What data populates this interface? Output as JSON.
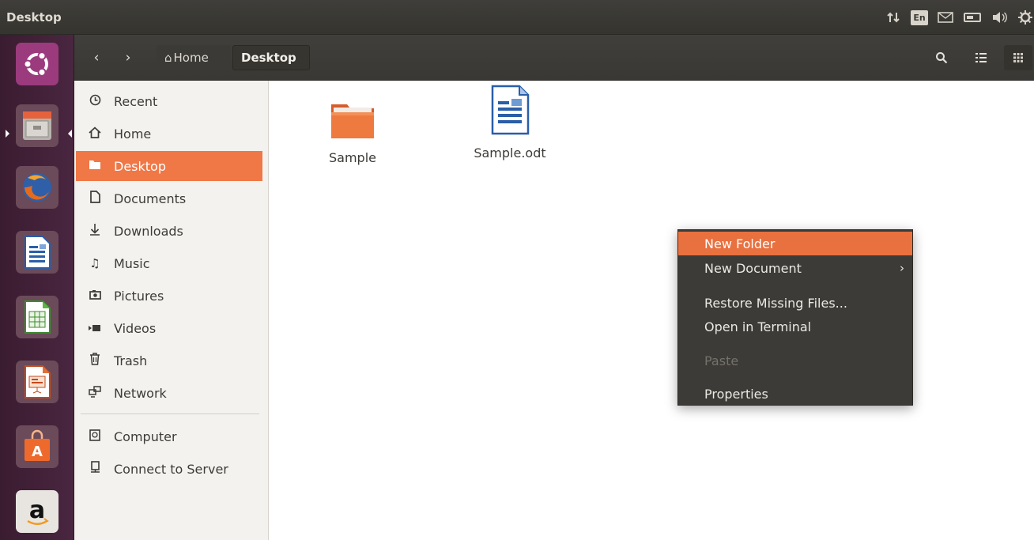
{
  "window": {
    "title": "Desktop"
  },
  "indicators": {
    "network": "network-updown-icon",
    "language": "En",
    "mail": "mail-icon",
    "battery": "battery-icon",
    "volume": "volume-icon",
    "settings": "gear-icon"
  },
  "launcher": {
    "items": [
      {
        "name": "ubuntu-dash",
        "icon": "ubuntu-logo-icon"
      },
      {
        "name": "files",
        "icon": "file-cabinet-icon"
      },
      {
        "name": "firefox",
        "icon": "firefox-icon"
      },
      {
        "name": "writer",
        "icon": "document-icon"
      },
      {
        "name": "calc",
        "icon": "spreadsheet-icon"
      },
      {
        "name": "impress",
        "icon": "presentation-icon"
      },
      {
        "name": "software-center",
        "icon": "shopping-bag-icon"
      },
      {
        "name": "amazon",
        "icon": "amazon-icon"
      }
    ]
  },
  "toolbar": {
    "back": "‹",
    "forward": "›",
    "breadcrumbs": [
      "Home",
      "Desktop"
    ],
    "search_icon": "search-icon",
    "list_view_icon": "list-view-icon",
    "grid_view_icon": "grid-view-icon"
  },
  "sidebar": {
    "items": [
      {
        "label": "Recent",
        "icon": "clock-icon"
      },
      {
        "label": "Home",
        "icon": "home-icon"
      },
      {
        "label": "Desktop",
        "icon": "folder-icon",
        "active": true
      },
      {
        "label": "Documents",
        "icon": "document-icon"
      },
      {
        "label": "Downloads",
        "icon": "download-icon"
      },
      {
        "label": "Music",
        "icon": "music-icon"
      },
      {
        "label": "Pictures",
        "icon": "camera-icon"
      },
      {
        "label": "Videos",
        "icon": "video-icon"
      },
      {
        "label": "Trash",
        "icon": "trash-icon"
      },
      {
        "label": "Network",
        "icon": "network-icon"
      },
      {
        "label": "Computer",
        "icon": "drive-icon"
      },
      {
        "label": "Connect to Server",
        "icon": "server-icon"
      }
    ]
  },
  "files": [
    {
      "label": "Sample",
      "icon": "folder-icon"
    },
    {
      "label": "Sample.odt",
      "icon": "odt-document-icon"
    }
  ],
  "context_menu": {
    "items": [
      {
        "label": "New Folder",
        "highlighted": true
      },
      {
        "label": "New Document",
        "submenu": "›"
      },
      {
        "label": "Restore Missing Files..."
      },
      {
        "label": "Open in Terminal"
      },
      {
        "label": "Paste",
        "disabled": true
      },
      {
        "label": "Properties"
      }
    ]
  },
  "colors": {
    "accent": "#f07746",
    "panel": "#3c3b37",
    "launcher": "#43223a"
  }
}
